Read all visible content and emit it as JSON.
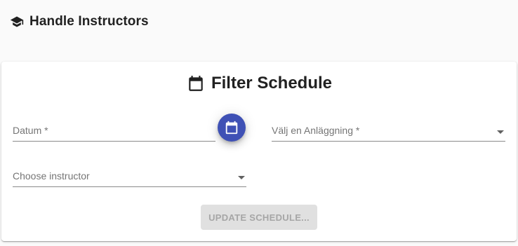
{
  "header": {
    "title": "Handle Instructors",
    "icon": "graduation-cap-icon"
  },
  "filter_card": {
    "title": "Filter Schedule",
    "title_icon": "calendar-icon",
    "date_field": {
      "label": "Datum *",
      "value": ""
    },
    "date_picker_button": {
      "icon": "calendar-icon",
      "color": "#3f51b5"
    },
    "facility_select": {
      "label": "Välj en Anläggning *",
      "value": ""
    },
    "instructor_select": {
      "label": "Choose instructor",
      "value": ""
    },
    "update_button": {
      "label": "UPDATE SCHEDULE...",
      "enabled": false
    }
  }
}
